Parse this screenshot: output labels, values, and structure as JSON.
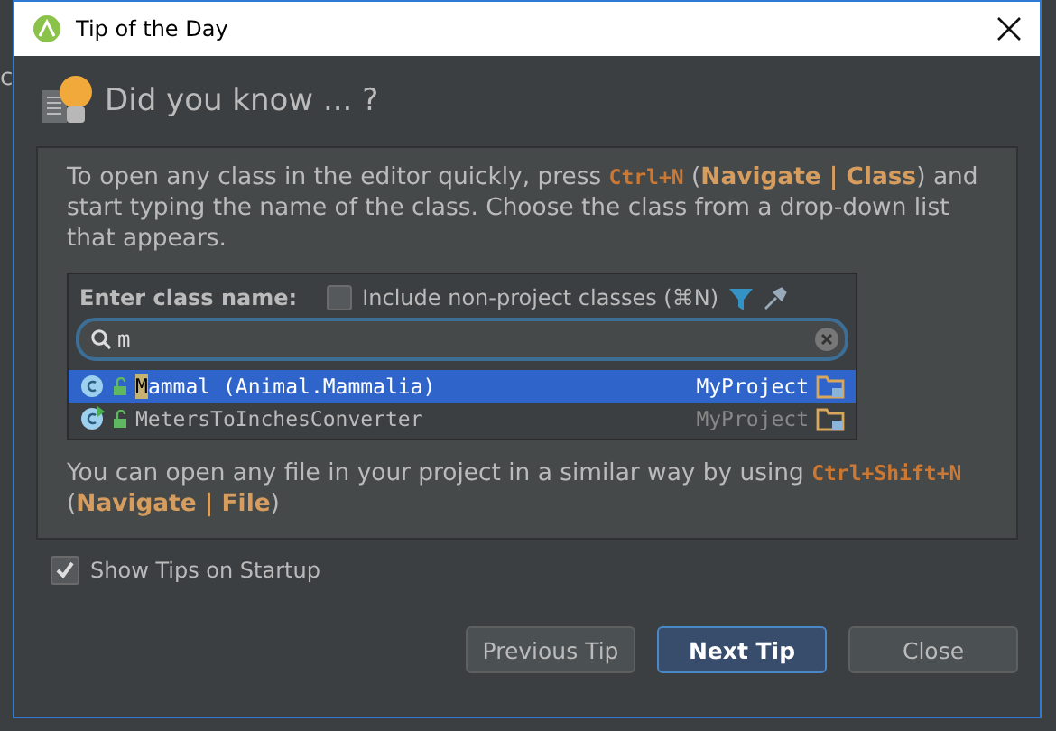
{
  "background": {
    "fragment": "c"
  },
  "window": {
    "title": "Tip of the Day"
  },
  "heading": "Did you know ... ?",
  "tip": {
    "intro": "To open any class in the editor quickly, press *Ctrl+N* (**Navigate | Class**) and start typing the name of the class. Choose the class from a drop-down list that appears.",
    "popup": {
      "label": "Enter class name:",
      "include_checkbox": {
        "label": "Include non-project classes (⌘N)",
        "checked": false
      },
      "search": {
        "value": "m"
      },
      "results": [
        {
          "match": "M",
          "rest": "ammal (Animal.Mammalia)",
          "module": "MyProject",
          "runnable": false,
          "selected": true
        },
        {
          "rest": "MetersToInchesConverter",
          "module": "MyProject",
          "runnable": true,
          "selected": false
        }
      ]
    },
    "outro": "You can open any file in your project in a similar way by using *Ctrl+Shift+N* (**Navigate | File**)"
  },
  "show_tips": {
    "label": "Show Tips on Startup",
    "checked": true
  },
  "buttons": [
    {
      "label": "Previous Tip",
      "kind": "normal"
    },
    {
      "label": "Next Tip",
      "kind": "default"
    },
    {
      "label": "Close",
      "kind": "normal"
    }
  ]
}
